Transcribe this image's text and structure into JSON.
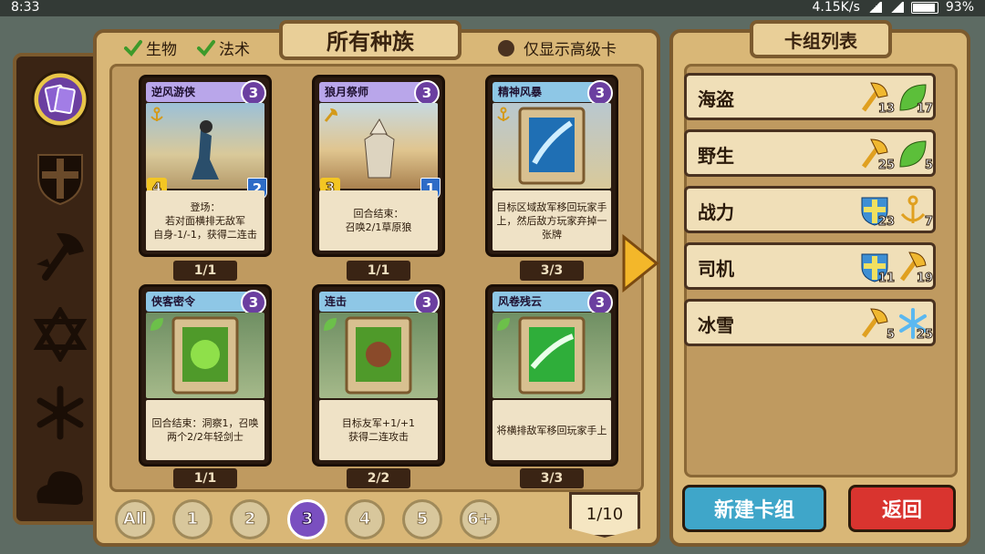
{
  "status": {
    "time": "8:33",
    "net": "4.15K/s",
    "battery": "93%"
  },
  "filters": {
    "creature": "生物",
    "spell": "法术",
    "premium": "仅显示高级卡",
    "title": "所有种族"
  },
  "sidebar": [
    "purple-cards",
    "shield",
    "axe",
    "hexagram",
    "snowflake",
    "cloud"
  ],
  "cards": [
    {
      "name": "逆风游侠",
      "cost": "3",
      "text": "登场：\n若对面横排无敌军\n自身-1/-1，获得二连击",
      "atk": "4",
      "hp": "2",
      "count": "1/1",
      "tribe": "anchor",
      "bar": "#b9a6ea"
    },
    {
      "name": "狼月祭师",
      "cost": "3",
      "text": "回合结束：\n召唤2/1草原狼",
      "atk": "3",
      "hp": "1",
      "count": "1/1",
      "tribe": "axe",
      "bar": "#b9a6ea"
    },
    {
      "name": "精神风暴",
      "cost": "3",
      "text": "目标区域敌军移回玩家手上，然后敌方玩家弃掉一张牌",
      "count": "3/3",
      "tribe": "anchor",
      "bar": "#8ec7e6"
    },
    {
      "name": "侠客密令",
      "cost": "3",
      "text": "回合结束：洞察1，召唤两个2/2年轻剑士",
      "count": "1/1",
      "tribe": "leaf",
      "bar": "#8ec7e6"
    },
    {
      "name": "连击",
      "cost": "3",
      "text": "目标友军+1/+1\n获得二连攻击",
      "count": "2/2",
      "tribe": "leaf",
      "bar": "#8ec7e6"
    },
    {
      "name": "风卷残云",
      "cost": "3",
      "text": "将横排敌军移回玩家手上",
      "count": "3/3",
      "tribe": "leaf",
      "bar": "#8ec7e6"
    }
  ],
  "pages": [
    "All",
    "1",
    "2",
    "3",
    "4",
    "5",
    "6+"
  ],
  "active_page": "3",
  "pager": "1/10",
  "deck_list": {
    "title": "卡组列表",
    "decks": [
      {
        "name": "海盗",
        "a": "13",
        "b": "17",
        "ia": "axe",
        "ib": "leaf"
      },
      {
        "name": "野生",
        "a": "25",
        "b": "5",
        "ia": "axe",
        "ib": "leaf"
      },
      {
        "name": "战力",
        "a": "23",
        "b": "7",
        "ia": "shield",
        "ib": "anchor"
      },
      {
        "name": "司机",
        "a": "11",
        "b": "19",
        "ia": "shield",
        "ib": "axe"
      },
      {
        "name": "冰雪",
        "a": "5",
        "b": "25",
        "ia": "axe",
        "ib": "snow"
      }
    ]
  },
  "buttons": {
    "new": "新建卡组",
    "back": "返回"
  }
}
